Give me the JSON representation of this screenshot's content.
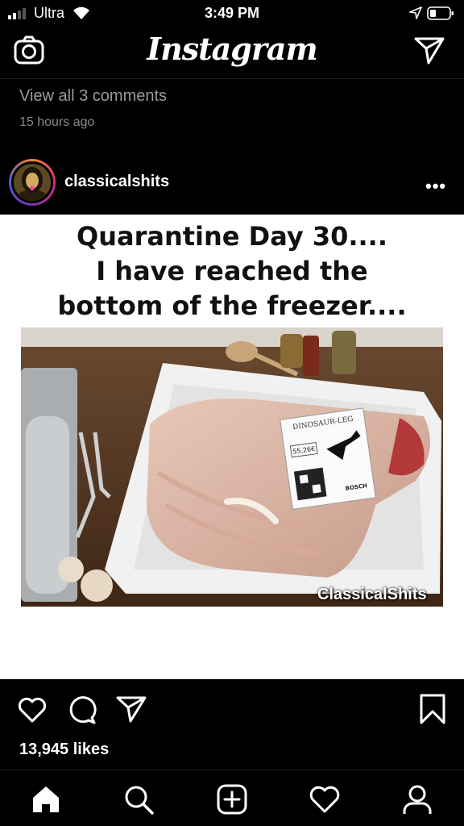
{
  "status_bar": {
    "carrier": "Ultra",
    "time": "3:49 PM"
  },
  "header": {
    "logo": "Instagram"
  },
  "previous_post": {
    "comments_link": "View all 3 comments",
    "time_ago": "15 hours ago"
  },
  "post": {
    "username": "classicalshits",
    "more_label": "•••",
    "caption_lines": [
      "Quarantine Day 30....",
      "I have reached the",
      "bottom of the freezer...."
    ],
    "label_text": "DINOSAUR-LEG",
    "price_text": "55,26€",
    "brand_text": "BOSCH",
    "watermark": "ClassicalShits",
    "likes": "13,945 likes"
  },
  "tabs": [
    "home",
    "search",
    "create",
    "activity",
    "profile"
  ],
  "colors": {
    "background": "#000000",
    "text": "#ffffff",
    "muted": "#9a9a9a"
  }
}
